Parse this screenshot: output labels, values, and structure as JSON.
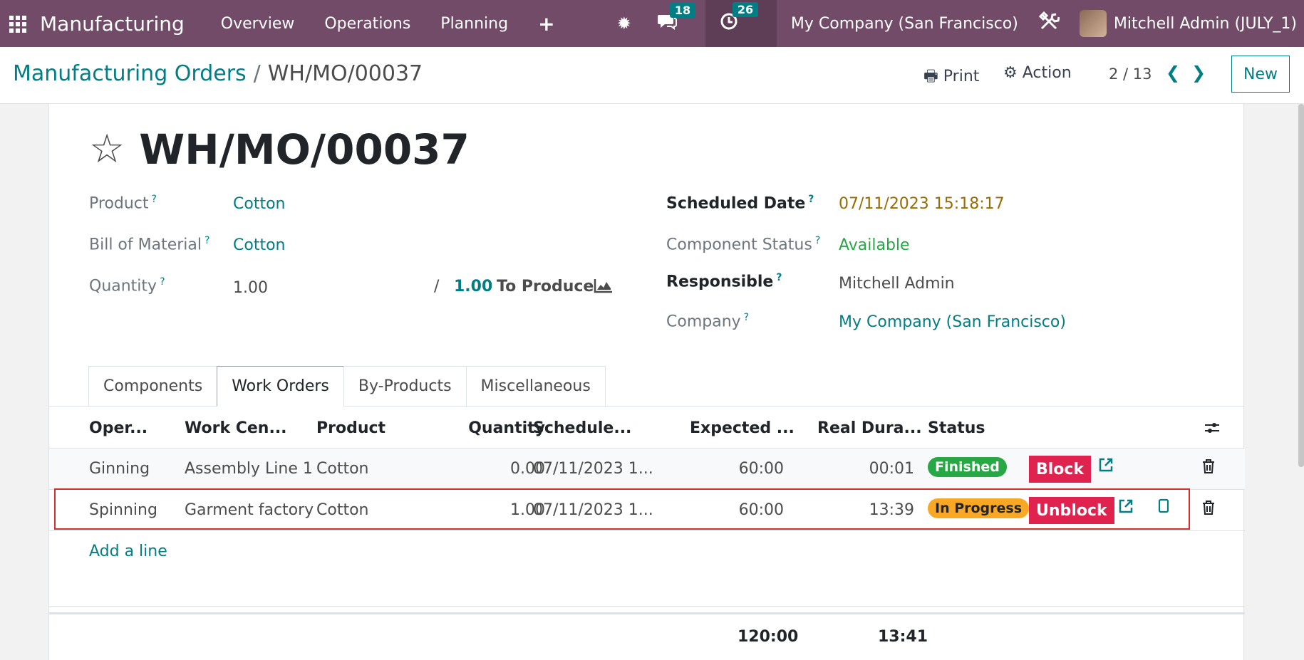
{
  "navbar": {
    "brand": "Manufacturing",
    "menu": [
      "Overview",
      "Operations",
      "Planning"
    ],
    "plus": "+",
    "messages_count": "18",
    "activities_count": "26",
    "company": "My Company (San Francisco)",
    "user": "Mitchell Admin (JULY_1)",
    "icons": {
      "apps": "apps-grid-icon",
      "debug": "bug-icon",
      "chat": "chat-icon",
      "activity": "clock-icon",
      "settings": "tools-icon"
    },
    "color": "#714b67"
  },
  "control_panel": {
    "breadcrumb_parent": "Manufacturing Orders",
    "breadcrumb_separator": "/",
    "breadcrumb_current": "WH/MO/00037",
    "print_label": "Print",
    "action_label": "Action",
    "pager": "2 / 13",
    "new_label": "New"
  },
  "record": {
    "title": "WH/MO/00037",
    "fields_left": {
      "product_label": "Product",
      "product_value": "Cotton",
      "bom_label": "Bill of Material",
      "bom_value": "Cotton",
      "quantity_label": "Quantity",
      "quantity_value": "1.00",
      "quantity_slash": "/",
      "quantity_to_produce": "1.00",
      "to_produce_label": "To Produce"
    },
    "fields_right": {
      "scheduled_date_label": "Scheduled Date",
      "scheduled_date_value": "07/11/2023 15:18:17",
      "component_status_label": "Component Status",
      "component_status_value": "Available",
      "responsible_label": "Responsible",
      "responsible_value": "Mitchell Admin",
      "company_label": "Company",
      "company_value": "My Company (San Francisco)"
    },
    "help_marker": "?"
  },
  "tabs": [
    "Components",
    "Work Orders",
    "By-Products",
    "Miscellaneous"
  ],
  "active_tab": "Work Orders",
  "table": {
    "headers": [
      "Oper...",
      "Work Cen...",
      "Product",
      "Quantity",
      "Schedule...",
      "Expected ...",
      "Real Dura...",
      "Status"
    ],
    "rows": [
      {
        "operation": "Ginning",
        "work_center": "Assembly Line 1",
        "product": "Cotton",
        "quantity": "0.00",
        "scheduled": "07/11/2023 1...",
        "expected": "60:00",
        "real": "00:01",
        "status": "Finished",
        "action": "Block"
      },
      {
        "operation": "Spinning",
        "work_center": "Garment factory",
        "product": "Cotton",
        "quantity": "1.00",
        "scheduled": "07/11/2023 1...",
        "expected": "60:00",
        "real": "13:39",
        "status": "In Progress",
        "action": "Unblock"
      }
    ],
    "add_line": "Add a line",
    "total_expected": "120:00",
    "total_real": "13:41"
  }
}
